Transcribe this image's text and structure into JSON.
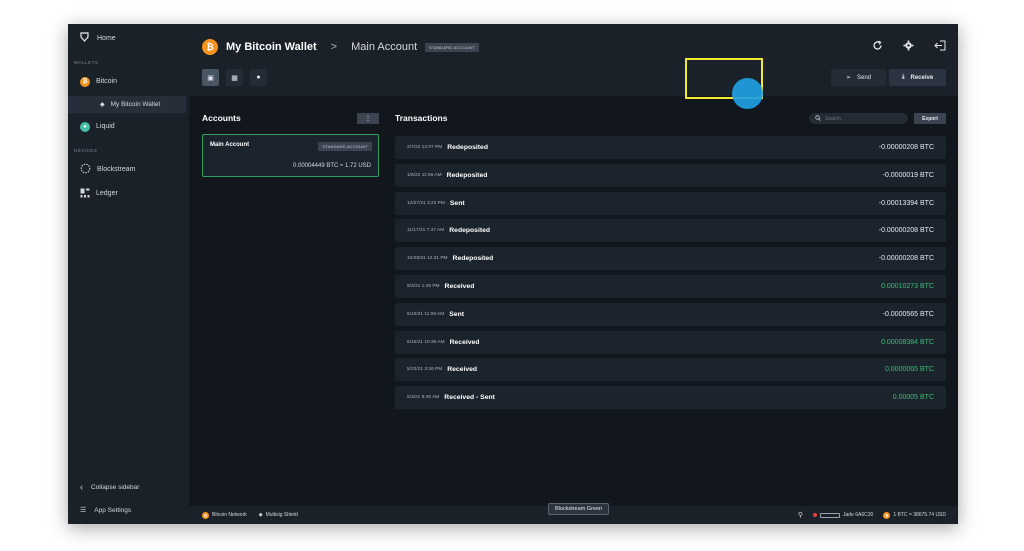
{
  "sidebar": {
    "home_label": "Home",
    "wallets_section": "WALLETS",
    "devices_section": "DEVICES",
    "items": [
      {
        "label": "Bitcoin",
        "icon": "bitcoin-icon"
      },
      {
        "label": "My Bitcoin Wallet",
        "icon": "wallet-tag-icon"
      },
      {
        "label": "Liquid",
        "icon": "liquid-icon"
      },
      {
        "label": "Blockstream",
        "icon": "blockstream-icon"
      },
      {
        "label": "Ledger",
        "icon": "ledger-icon"
      }
    ],
    "collapse_label": "Collapse sidebar",
    "settings_label": "App Settings"
  },
  "header": {
    "wallet_title": "My Bitcoin Wallet",
    "separator": ">",
    "account_title": "Main Account",
    "account_badge": "STANDARD ACCOUNT",
    "send_label": "Send",
    "receive_label": "Receive"
  },
  "accounts": {
    "title": "Accounts",
    "more_label": "⋮",
    "card": {
      "name": "Main Account",
      "badge": "STANDARD ACCOUNT",
      "balance": "0.00004449 BTC  ≈ 1.72 USD"
    }
  },
  "transactions": {
    "title": "Transactions",
    "search_placeholder": "Search",
    "export_label": "Export",
    "rows": [
      {
        "date": "2/7/22 12:07 PM",
        "label": "Redeposited",
        "amount": "-0.00000208 BTC",
        "positive": false
      },
      {
        "date": "1/6/22 11:56 AM",
        "label": "Redeposited",
        "amount": "-0.0000019 BTC",
        "positive": false
      },
      {
        "date": "12/27/21 3:23 PM",
        "label": "Sent",
        "amount": "-0.00013394 BTC",
        "positive": false
      },
      {
        "date": "11/17/21 7:47 AM",
        "label": "Redeposited",
        "amount": "-0.00000208 BTC",
        "positive": false
      },
      {
        "date": "10/28/21 12:31 PM",
        "label": "Redeposited",
        "amount": "-0.00000208 BTC",
        "positive": false
      },
      {
        "date": "9/3/21 1:49 PM",
        "label": "Received",
        "amount": "0.00010273 BTC",
        "positive": true
      },
      {
        "date": "6/15/21 11:09 AM",
        "label": "Sent",
        "amount": "-0.0000565 BTC",
        "positive": false
      },
      {
        "date": "6/15/21 10:35 AM",
        "label": "Received",
        "amount": "0.00008384 BTC",
        "positive": true
      },
      {
        "date": "5/23/21 3:26 PM",
        "label": "Received",
        "amount": "0.0000065 BTC",
        "positive": true
      },
      {
        "date": "5/3/21 9:46 AM",
        "label": "Received - Sent",
        "amount": "0.00005 BTC",
        "positive": true
      }
    ]
  },
  "status_bar": {
    "network": "Bitcoin Network",
    "shield": "Multisig Shield",
    "tooltip": "Blockstream Green",
    "device": "Jade 6A6C30",
    "rate": "1 BTC = 38675.74 USD"
  },
  "colors": {
    "accent_positive": "#38c172",
    "highlight": "#f2ea2e",
    "cursor": "#1fa0e3",
    "bitcoin": "#f7931a"
  }
}
